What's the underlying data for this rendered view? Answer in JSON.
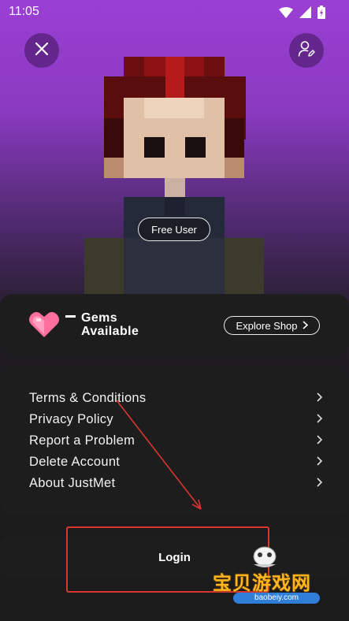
{
  "status_bar": {
    "time": "11:05"
  },
  "icons": {
    "close": "close-icon",
    "profile_edit": "user-edit-icon",
    "heart": "gem-heart-icon",
    "chevron": "chevron-right-icon"
  },
  "avatar": {
    "badge": "Free User"
  },
  "gems": {
    "count": "–",
    "label_line1": "Gems",
    "label_line2": "Available",
    "shop_button": "Explore Shop"
  },
  "menu": {
    "items": [
      {
        "label": "Terms & Conditions"
      },
      {
        "label": "Privacy Policy"
      },
      {
        "label": "Report a Problem"
      },
      {
        "label": "Delete Account"
      },
      {
        "label": "About JustMet"
      }
    ]
  },
  "login": {
    "label": "Login"
  },
  "watermark": {
    "text": "宝贝游戏网",
    "url": "baobeiy.com"
  },
  "colors": {
    "accent_purple": "#9a3fd3",
    "card_bg": "#1d1d1e",
    "annotation_red": "#d9362f",
    "gem_pink": "#ff6f9c"
  }
}
